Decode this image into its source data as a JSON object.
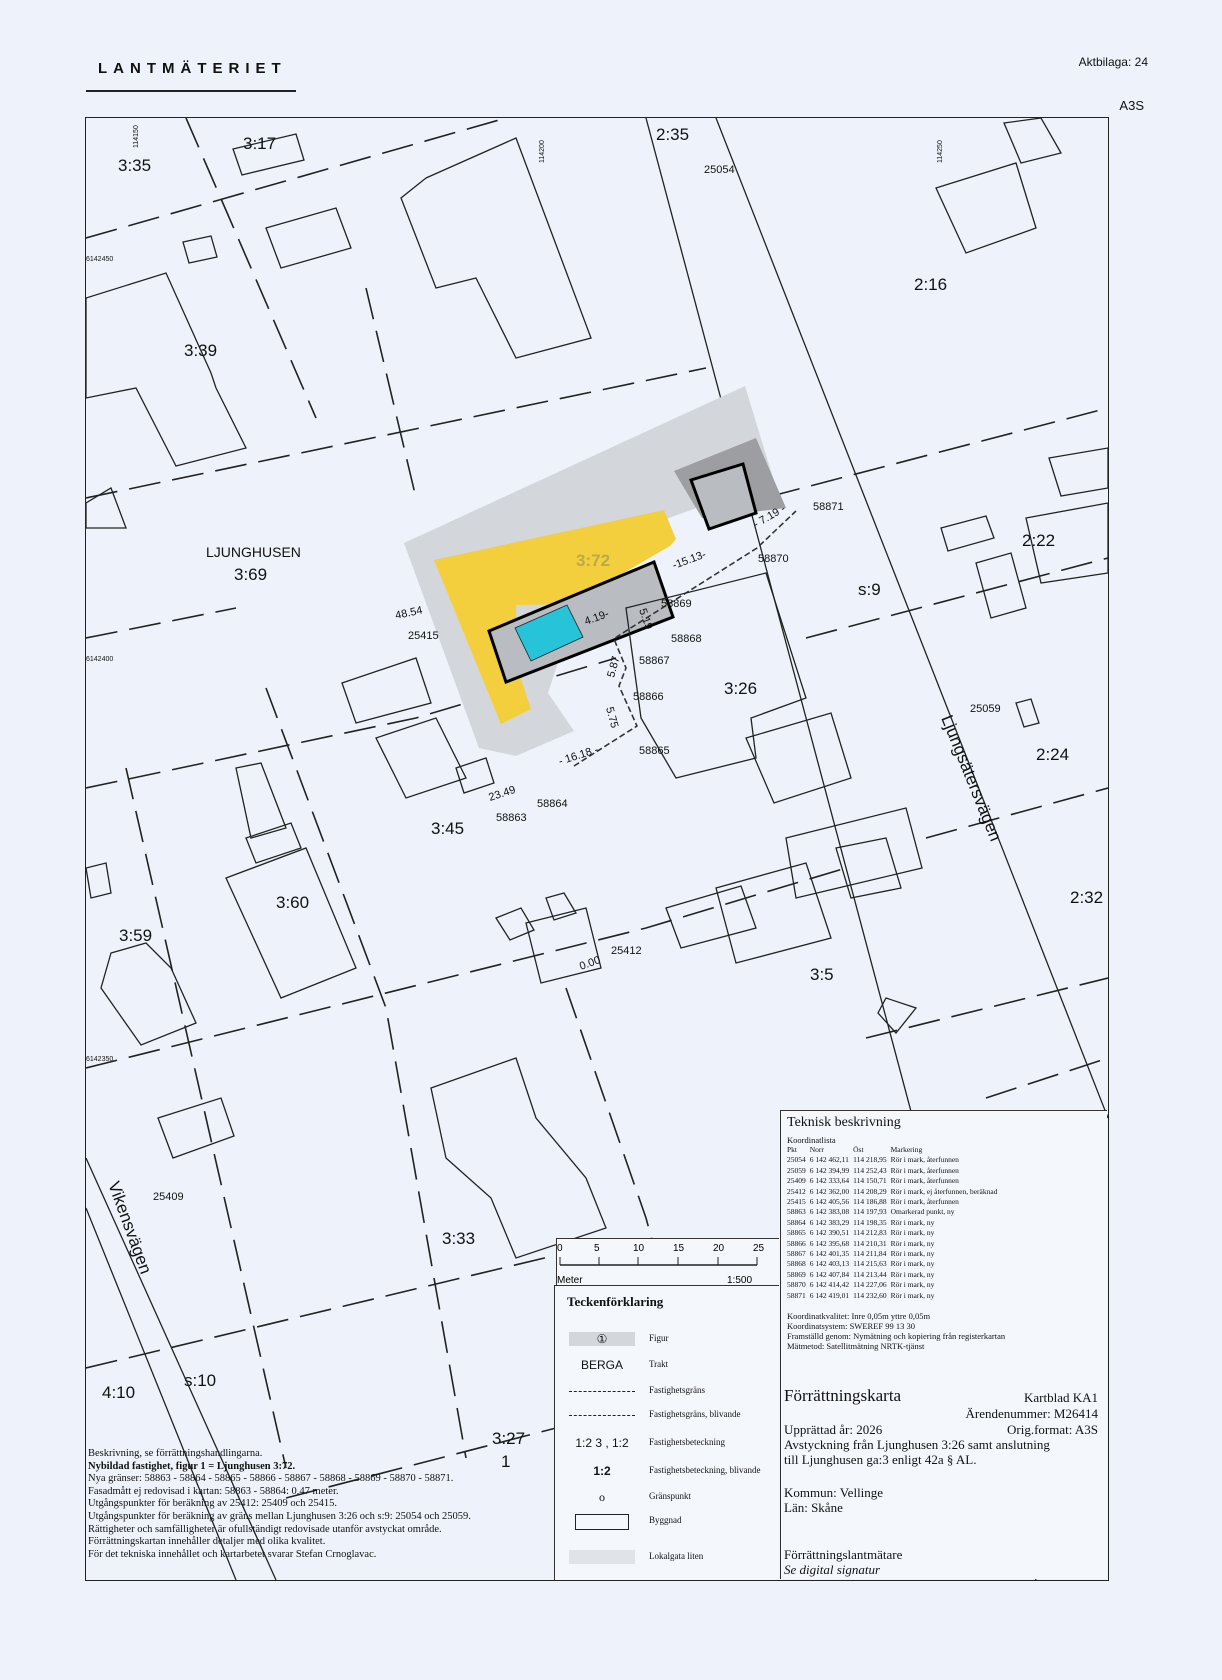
{
  "header": {
    "org": "LANTMÄTERIET",
    "aktbilaga": "Aktbilaga: 24",
    "format": "A3S"
  },
  "map": {
    "labels": {
      "p3_35": "3:35",
      "p3_17": "3:17",
      "p2_35": "2:35",
      "p2_16": "2:16",
      "p3_39": "3:39",
      "ljunghusen": "LJUNGHUSEN",
      "p3_69": "3:69",
      "p3_72": "3:72",
      "p2_22": "2:22",
      "s9": "s:9",
      "p3_26": "3:26",
      "p2_24": "2:24",
      "ljungsater": "Ljungsätersvägen",
      "p3_45": "3:45",
      "p3_60": "3:60",
      "p3_59": "3:59",
      "p2_32": "2:32",
      "p3_5": "3:5",
      "p3_33": "3:33",
      "vikens": "Vikensvägen",
      "p4_10": "4:10",
      "s10": "s:10",
      "p3_27": "3:27",
      "fig1": "1"
    },
    "points": {
      "pt25054": "25054",
      "pt58871": "58871",
      "pt58870": "58870",
      "pt58869": "58869",
      "pt58868": "58868",
      "pt58867": "58867",
      "pt58866": "58866",
      "pt58865": "58865",
      "pt58864": "58864",
      "pt58863": "58863",
      "pt25415": "25415",
      "pt25059": "25059",
      "pt25412": "25412",
      "pt25409": "25409"
    },
    "measures": {
      "m1513": "-15.13-",
      "m719": "- 7.19 -",
      "m519": "5.19",
      "m419": "4.19-",
      "m587": "5.87",
      "m575": "5.75",
      "m1618": "- 16.18 -",
      "m2349": "23.49",
      "m4854": "48.54",
      "m000": "0.00"
    },
    "coords": {
      "c1": "114150",
      "c2": "114200",
      "c3": "114250",
      "c4": "6142450",
      "c5": "6142400",
      "c6": "6142350"
    }
  },
  "scale": {
    "ticks": [
      "0",
      "5",
      "10",
      "15",
      "20",
      "25"
    ],
    "unit": "Meter",
    "ratio": "1:500"
  },
  "legend": {
    "title": "Teckenförklaring",
    "figur": "Figur",
    "figur_sym": "①",
    "trakt_sym": "BERGA",
    "trakt": "Trakt",
    "fgrans": "Fastighetsgräns",
    "fgrans_bliv": "Fastighetsgräns, blivande",
    "fbet_sym": "1:2 3 , 1:2",
    "fbet": "Fastighetsbeteckning",
    "fbet_bliv_sym": "1:2",
    "fbet_bliv": "Fastighetsbeteckning, blivande",
    "gp_sym": "o",
    "gp": "Gränspunkt",
    "byggnad": "Byggnad",
    "lokalgata": "Lokalgata liten"
  },
  "technical": {
    "title": "Teknisk beskrivning",
    "subtitle": "Koordinatlista",
    "headers": [
      "Pkt",
      "Norr",
      "Öst",
      "Markering"
    ],
    "rows": [
      [
        "25054",
        "6 142 462,11",
        "114 218,95",
        "Rör i mark, återfunnen"
      ],
      [
        "25059",
        "6 142 394,99",
        "114 252,43",
        "Rör i mark, återfunnen"
      ],
      [
        "25409",
        "6 142 333,64",
        "114 150,71",
        "Rör i mark, återfunnen"
      ],
      [
        "25412",
        "6 142 362,00",
        "114 208,29",
        "Rör i mark, ej återfunnen, beräknad"
      ],
      [
        "25415",
        "6 142 405,56",
        "114 186,88",
        "Rör i mark, återfunnen"
      ],
      [
        "58863",
        "6 142 383,08",
        "114 197,93",
        "Omarkerad punkt, ny"
      ],
      [
        "58864",
        "6 142 383,29",
        "114 198,35",
        "Rör i mark, ny"
      ],
      [
        "58865",
        "6 142 390,51",
        "114 212,83",
        "Rör i mark, ny"
      ],
      [
        "58866",
        "6 142 395,68",
        "114 210,31",
        "Rör i mark, ny"
      ],
      [
        "58867",
        "6 142 401,35",
        "114 211,84",
        "Rör i mark, ny"
      ],
      [
        "58868",
        "6 142 403,13",
        "114 215,63",
        "Rör i mark, ny"
      ],
      [
        "58869",
        "6 142 407,84",
        "114 213,44",
        "Rör i mark, ny"
      ],
      [
        "58870",
        "6 142 414,42",
        "114 227,06",
        "Rör i mark, ny"
      ],
      [
        "58871",
        "6 142 419,01",
        "114 232,60",
        "Rör i mark, ny"
      ]
    ],
    "quality": "Koordinatkvalitet: Inre 0,05m yttre 0,05m",
    "system": "Koordinatsystem: SWEREF 99 13 30",
    "method1": "Framställd genom: Nymätning och kopiering från registerkartan",
    "method2": "Mätmetod: Satellitmätning NRTK-tjänst"
  },
  "forrattning": {
    "title": "Förrättningskarta",
    "kartblad": "Kartblad KA1",
    "arende": "Ärendenummer: M26414",
    "orig": "Orig.format: A3S",
    "upprattad": "Upprättad år: 2026",
    "avst1": "Avstyckning från Ljunghusen 3:26 samt anslutning",
    "avst2": "till Ljunghusen ga:3 enligt 42a § AL.",
    "kommun": "Kommun: Vellinge",
    "lan": "Län: Skåne",
    "lantmatare": "Förrättningslantmätare",
    "signatur": "Se digital signatur"
  },
  "description": {
    "l1": "Beskrivning, se förrättningshandlingarna.",
    "l2": "Nybildad fastighet, figur 1 = Ljunghusen 3:72.",
    "l3": "Nya gränser: 58863 - 58864 - 58865 - 58866 - 58867 - 58868 - 58869 - 58870 - 58871.",
    "l4": "Fasadmått ej redovisad i kartan: 58863 - 58864: 0,47 meter.",
    "l5": "Utgångspunkter för beräkning av 25412: 25409 och 25415.",
    "l6": "Utgångspunkter för beräkning av gräns mellan Ljunghusen 3:26 och s:9: 25054 och 25059.",
    "l7": "Rättigheter och samfälligheter är ofullständigt redovisade utanför avstyckat område.",
    "l8": "Förrättningskartan innehåller detaljer med olika kvalitet.",
    "l9": "För det tekniska innehållet och kartarbetet svarar Stefan Crnoglavac."
  },
  "colors": {
    "yellow": "#f3cf3d",
    "cyan": "#26c3d9",
    "grey": "#b9bcc0",
    "darkgrey": "#9c9ea1",
    "lightgrey": "#d3d6da"
  }
}
